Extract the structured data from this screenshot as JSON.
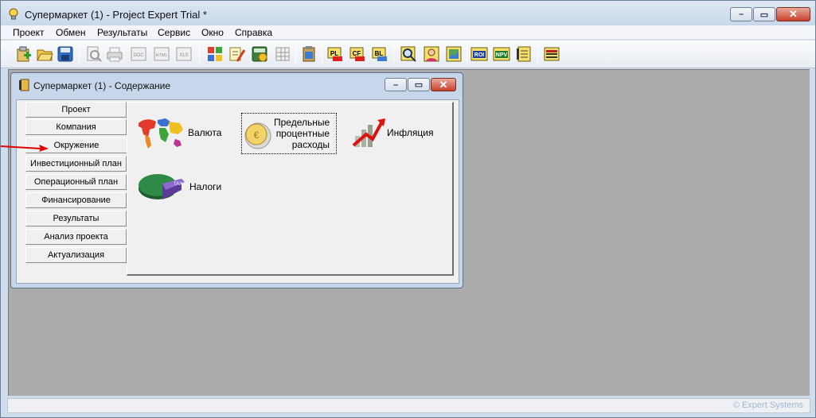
{
  "window": {
    "title": "Супермаркет (1) - Project Expert Trial *"
  },
  "menu": [
    "Проект",
    "Обмен",
    "Результаты",
    "Сервис",
    "Окно",
    "Справка"
  ],
  "toolbar_icons": [
    "new-icon",
    "open-icon",
    "save-icon",
    "preview-icon",
    "print-icon",
    "doc-export-icon",
    "html-export-icon",
    "xls-export-icon",
    "checklist-icon",
    "edit-notes-icon",
    "calculator-icon",
    "table-icon",
    "clipboard-icon",
    "pl-report-icon",
    "cf-report-icon",
    "bl-report-icon",
    "magnifier-icon",
    "user-icon",
    "chart-image-icon",
    "roi-icon",
    "npv-icon",
    "notebook-icon",
    "spreadsheet-icon"
  ],
  "child_window": {
    "title": "Супермаркет (1) - Содержание"
  },
  "nav": {
    "items": [
      "Проект",
      "Компания",
      "Окружение",
      "Инвестиционный план",
      "Операционный план",
      "Финансирование",
      "Результаты",
      "Анализ проекта",
      "Актуализация"
    ],
    "selected": "Окружение"
  },
  "content": {
    "currency": "Валюта",
    "interest_line1": "Предельные",
    "interest_line2": "процентные",
    "interest_line3": "расходы",
    "inflation": "Инфляция",
    "taxes": "Налоги"
  },
  "status": {
    "brand": "© Expert Systems"
  },
  "colors": {
    "accent": "#e00000",
    "mdi_bg": "#ababab"
  }
}
